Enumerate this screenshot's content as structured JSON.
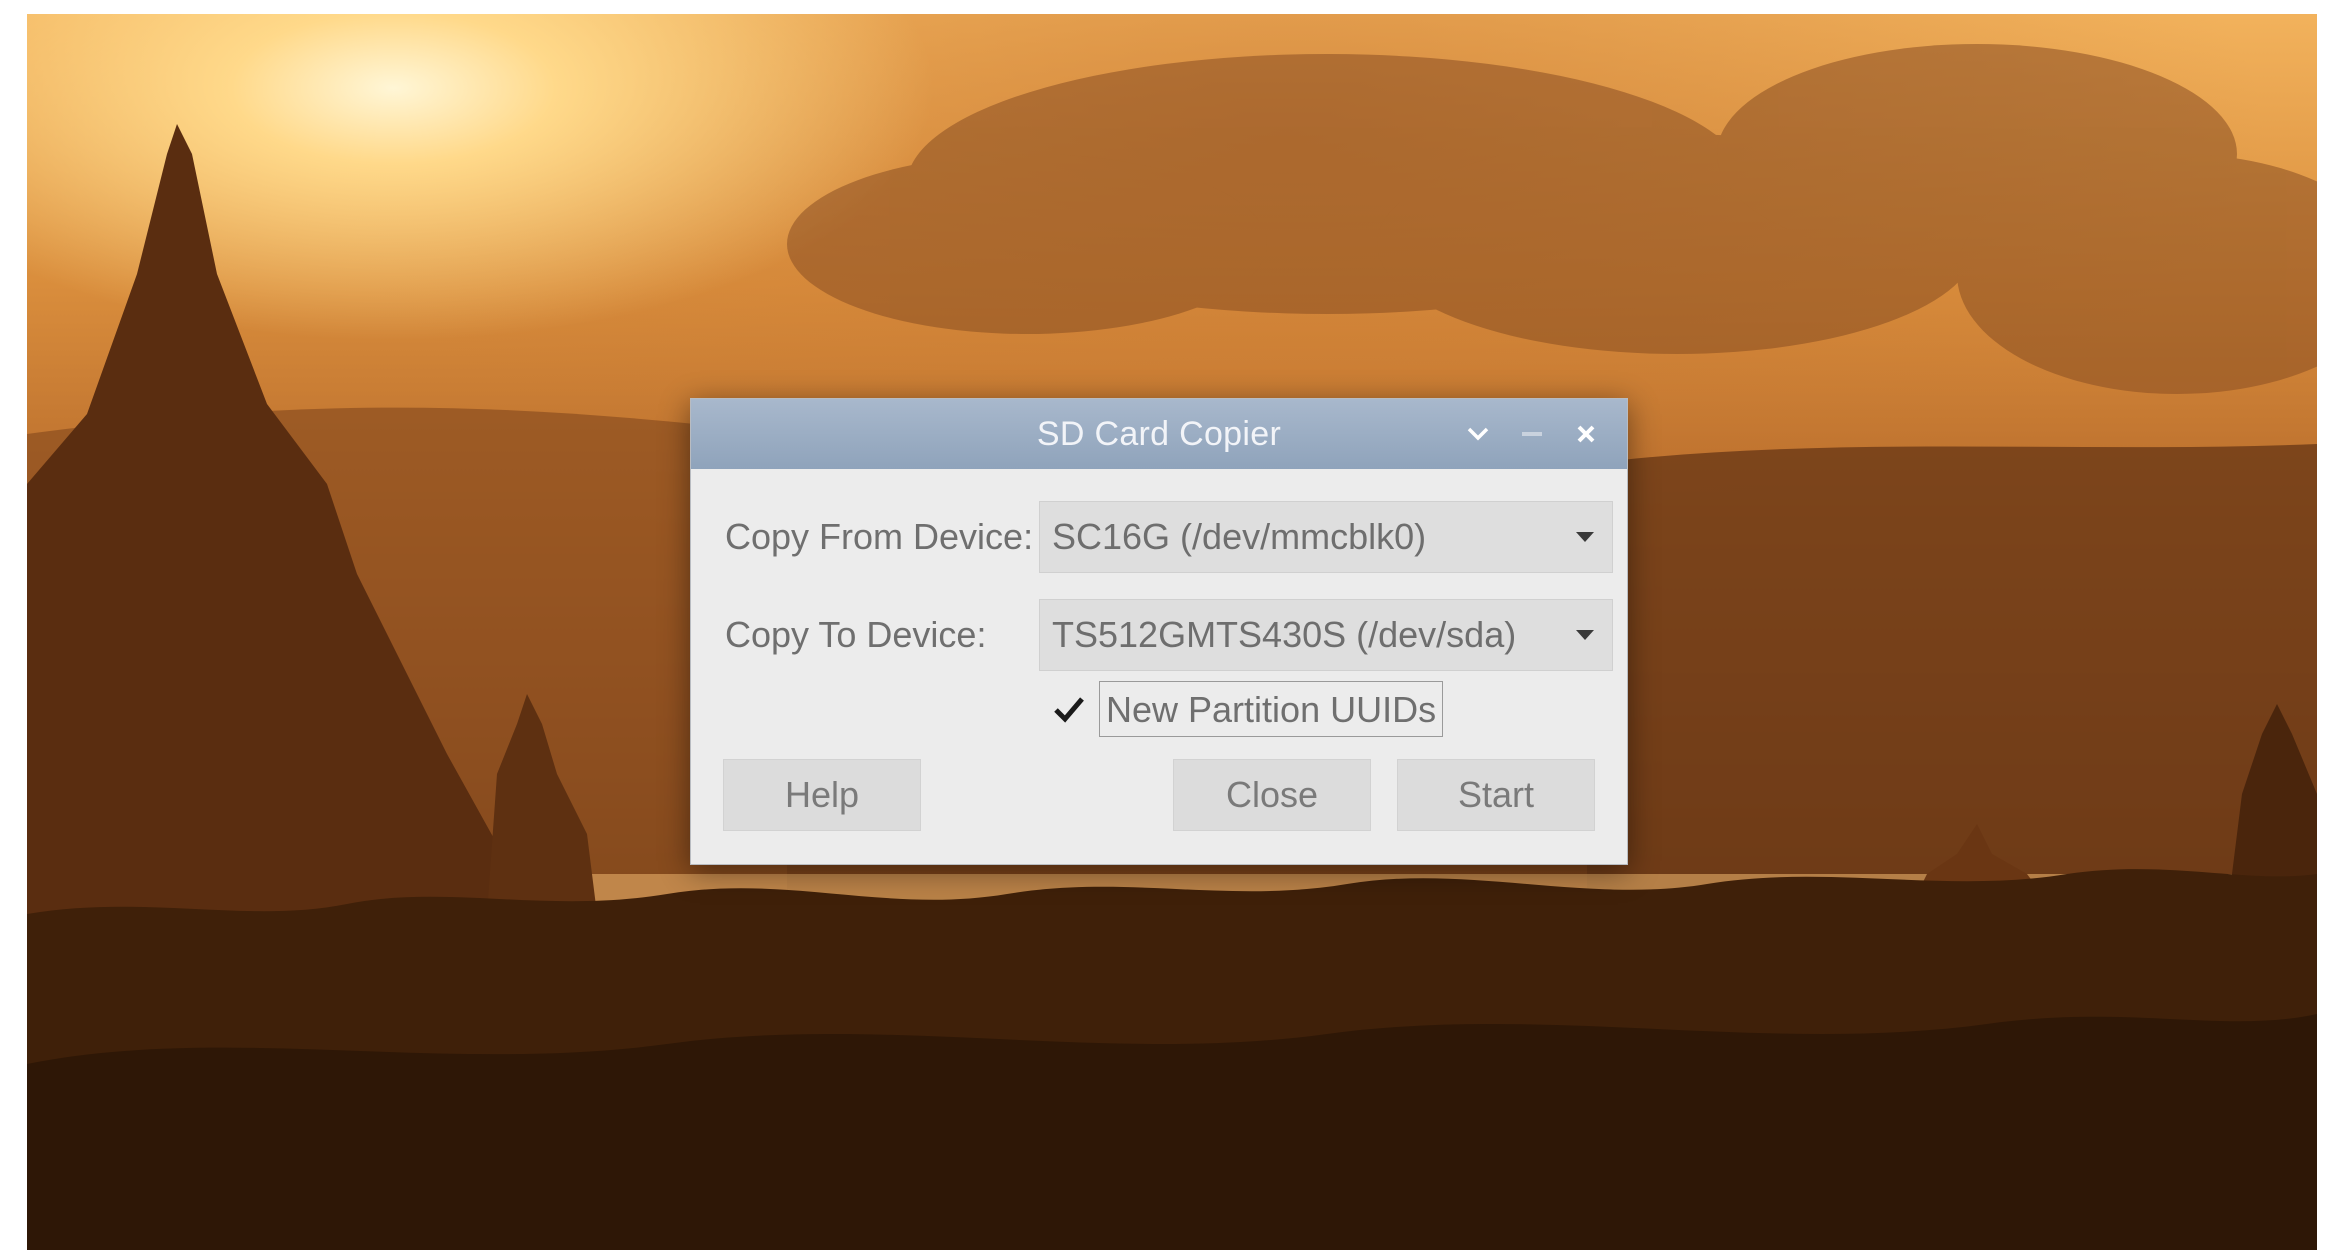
{
  "window": {
    "title": "SD Card Copier",
    "controls": {
      "dropdown_icon": "chevron-down-icon",
      "minimize_icon": "minimize-icon",
      "close_icon": "close-icon"
    }
  },
  "form": {
    "copy_from": {
      "label": "Copy From Device:",
      "value": "SC16G  (/dev/mmcblk0)"
    },
    "copy_to": {
      "label": "Copy To Device:",
      "value": "TS512GMTS430S  (/dev/sda)"
    },
    "new_partition_uuids": {
      "label": "New Partition UUIDs",
      "checked": true
    }
  },
  "buttons": {
    "help": "Help",
    "close": "Close",
    "start": "Start"
  },
  "colors": {
    "titlebar": "#8fa3bb",
    "dialog_bg": "#ececec",
    "field_bg": "#dedede",
    "button_bg": "#dcdcdc"
  }
}
